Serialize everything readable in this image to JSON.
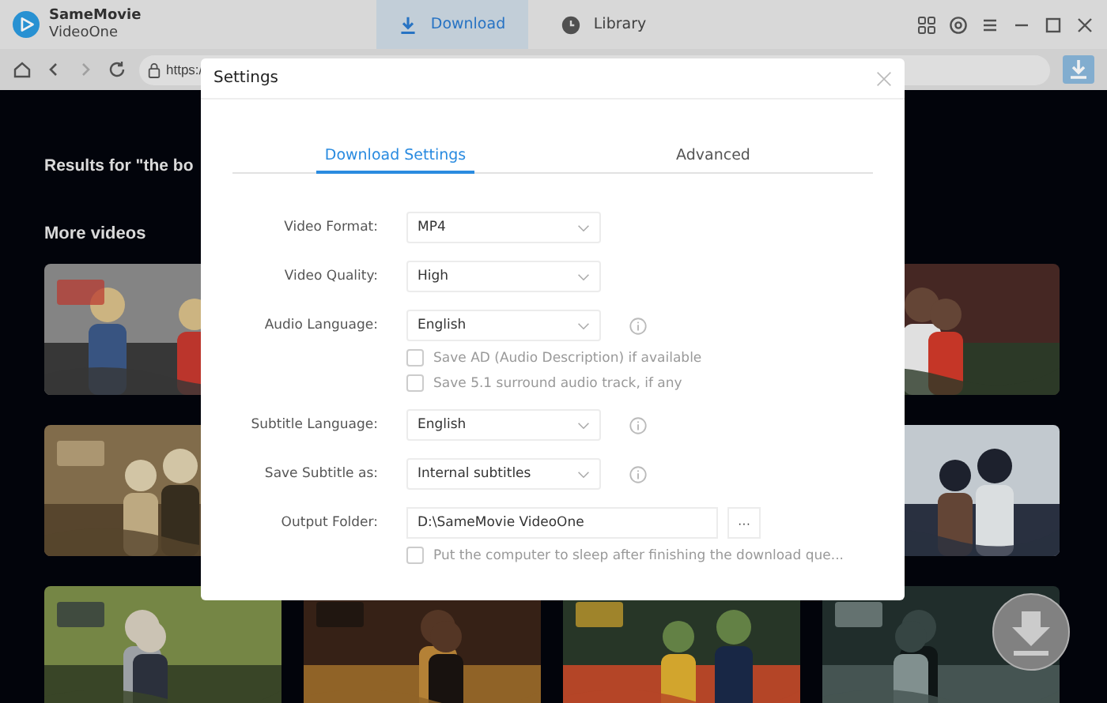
{
  "app": {
    "name": "SameMovie",
    "subtitle": "VideoOne"
  },
  "tabs": [
    {
      "label": "Download",
      "kind": "download",
      "selected": true
    },
    {
      "label": "Library",
      "kind": "library",
      "selected": false
    }
  ],
  "address_bar": {
    "value": "https:/"
  },
  "content": {
    "results_heading": "Results for \"the bo",
    "section_heading": "More videos"
  },
  "dialog": {
    "title": "Settings",
    "tabs": [
      {
        "label": "Download Settings",
        "selected": true
      },
      {
        "label": "Advanced",
        "selected": false
      }
    ],
    "fields": [
      {
        "kind": "select",
        "label": "Video Format:",
        "value": "MP4",
        "info": false
      },
      {
        "kind": "select",
        "label": "Video Quality:",
        "value": "High",
        "info": false
      },
      {
        "kind": "select",
        "label": "Audio Language:",
        "value": "English",
        "info": true
      },
      {
        "kind": "checkbox",
        "label": "Save AD (Audio Description) if available",
        "checked": false
      },
      {
        "kind": "checkbox",
        "label": "Save 5.1 surround audio track, if any",
        "checked": false
      },
      {
        "kind": "select",
        "label": "Subtitle Language:",
        "value": "English",
        "info": true
      },
      {
        "kind": "select",
        "label": "Save Subtitle as:",
        "value": "Internal subtitles",
        "info": true
      },
      {
        "kind": "folder",
        "label": "Output Folder:",
        "value": "D:\\SameMovie VideoOne",
        "button": "···"
      },
      {
        "kind": "checkbox",
        "label": "Put the computer to sleep after finishing the download que...",
        "checked": false
      }
    ]
  }
}
